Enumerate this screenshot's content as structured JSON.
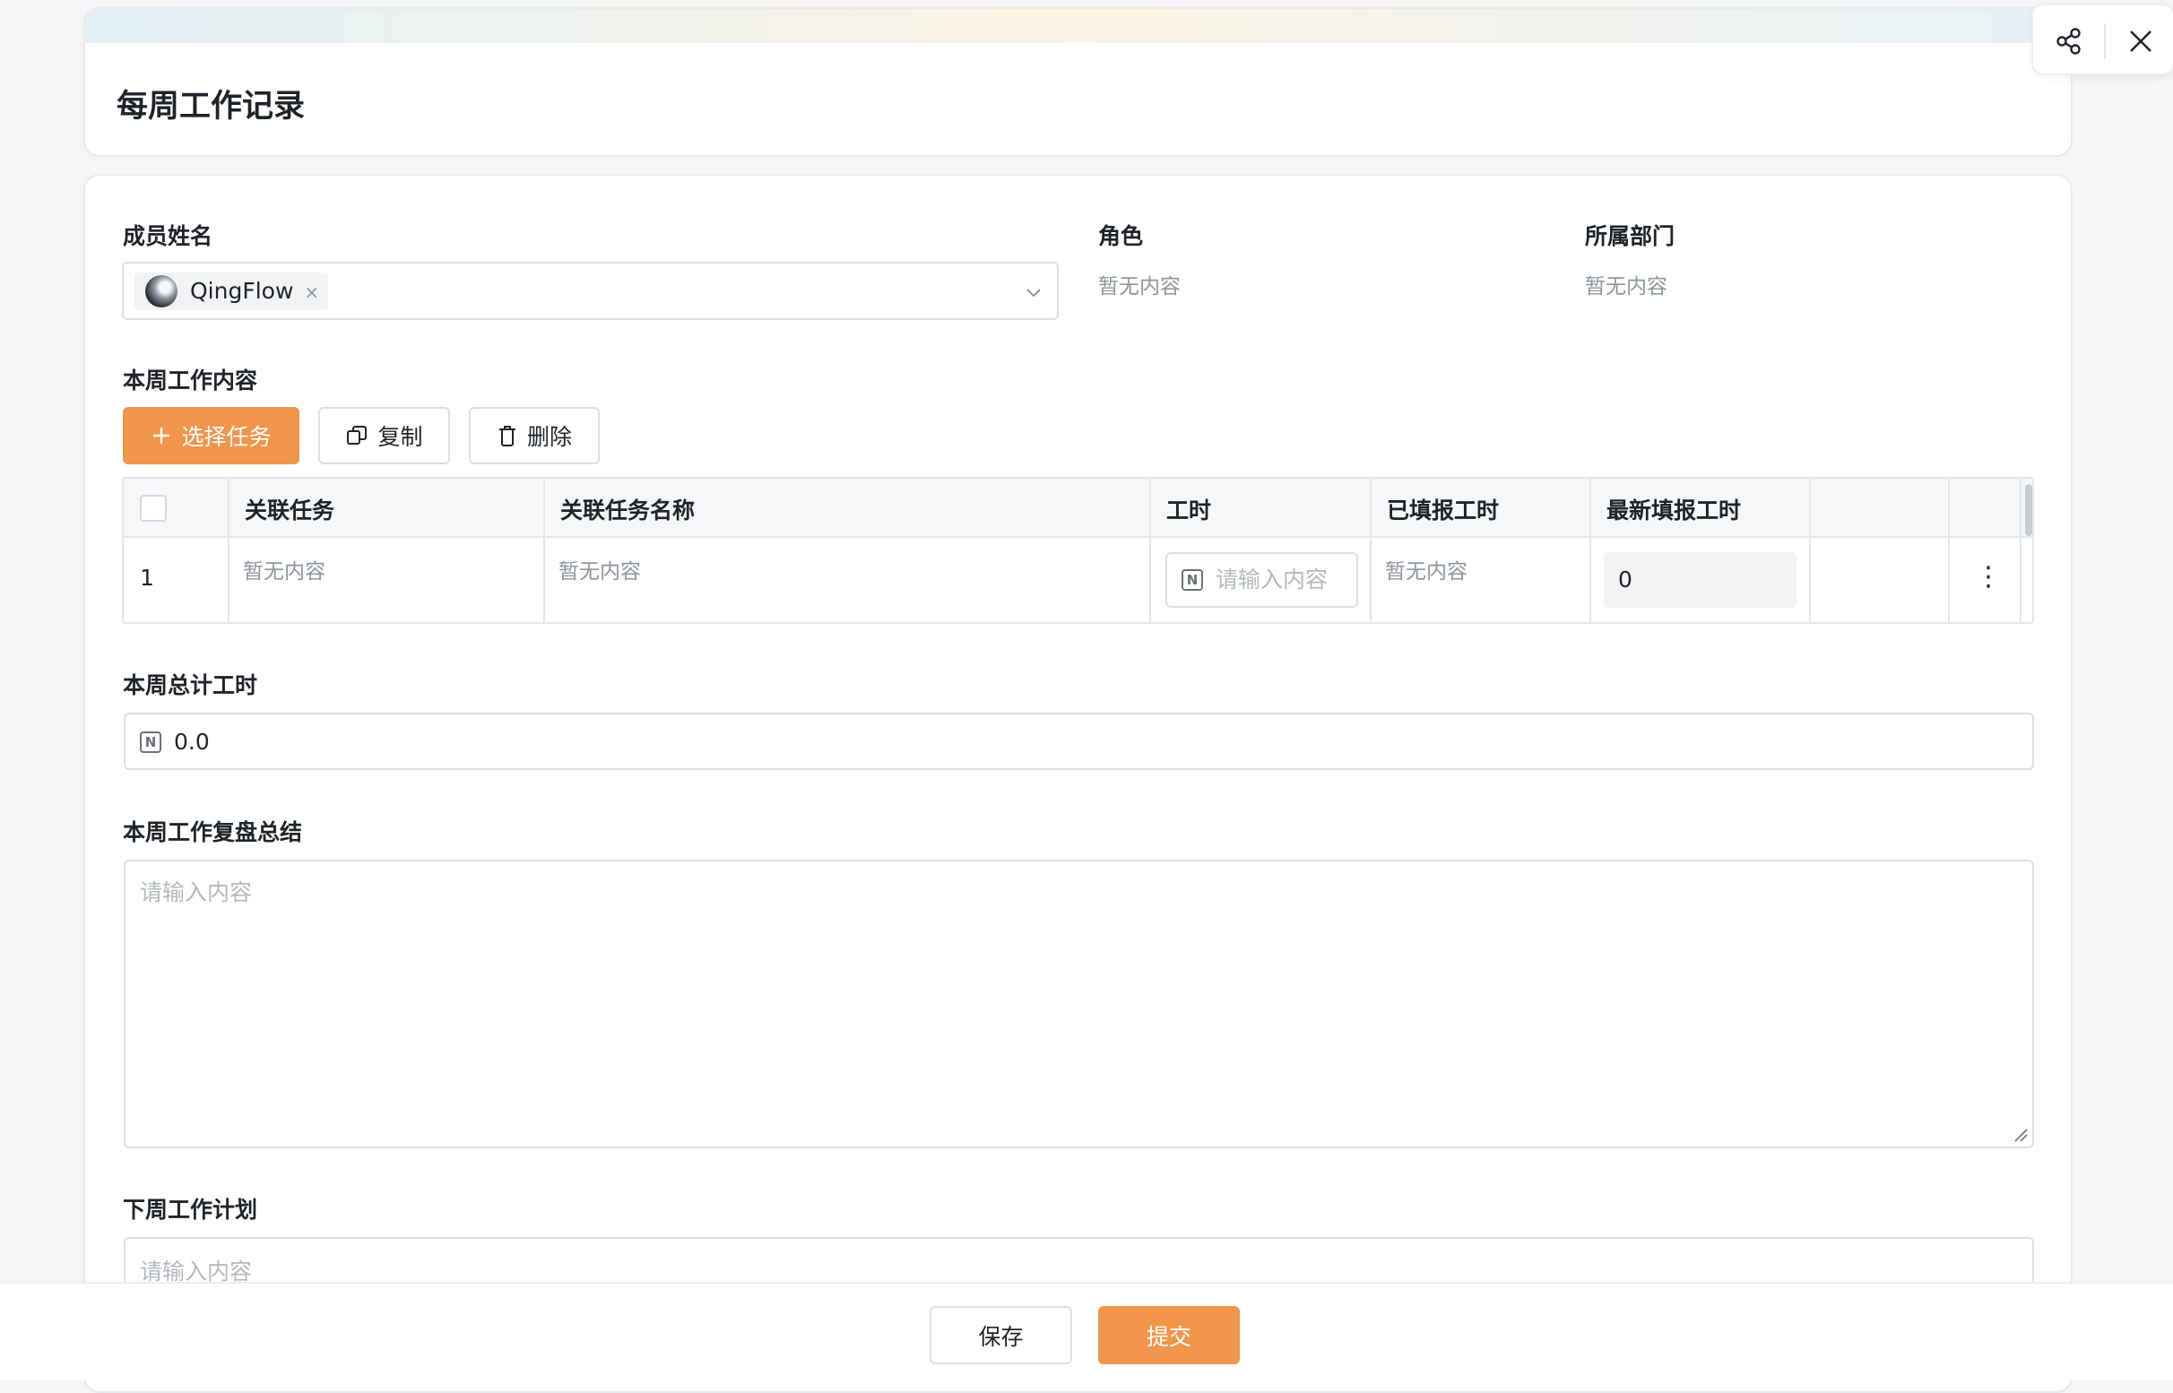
{
  "header": {
    "title": "每周工作记录"
  },
  "toolbar": {
    "share_icon": "share-icon",
    "close_icon": "close-icon"
  },
  "form": {
    "member": {
      "label": "成员姓名",
      "selected_user": "QingFlow",
      "remove_glyph": "×"
    },
    "role": {
      "label": "角色",
      "value": "暂无内容"
    },
    "department": {
      "label": "所属部门",
      "value": "暂无内容"
    },
    "weekly_content": {
      "label": "本周工作内容",
      "buttons": {
        "add": "选择任务",
        "copy": "复制",
        "delete": "删除"
      },
      "table": {
        "columns": [
          "关联任务",
          "关联任务名称",
          "工时",
          "已填报工时",
          "最新填报工时"
        ],
        "rows": [
          {
            "index": "1",
            "task": "暂无内容",
            "task_name": "暂无内容",
            "hours_placeholder": "请输入内容",
            "reported_hours": "暂无内容",
            "latest_hours": "0",
            "more_glyph": "⋮"
          }
        ]
      }
    },
    "total_hours": {
      "label": "本周总计工时",
      "value": "0.0"
    },
    "review": {
      "label": "本周工作复盘总结",
      "placeholder": "请输入内容"
    },
    "next_plan": {
      "label": "下周工作计划",
      "placeholder": "请输入内容"
    }
  },
  "footer": {
    "save": "保存",
    "submit": "提交"
  },
  "colors": {
    "accent": "#f0954a",
    "muted_text": "#8f959e",
    "border": "#dcdfe4"
  }
}
